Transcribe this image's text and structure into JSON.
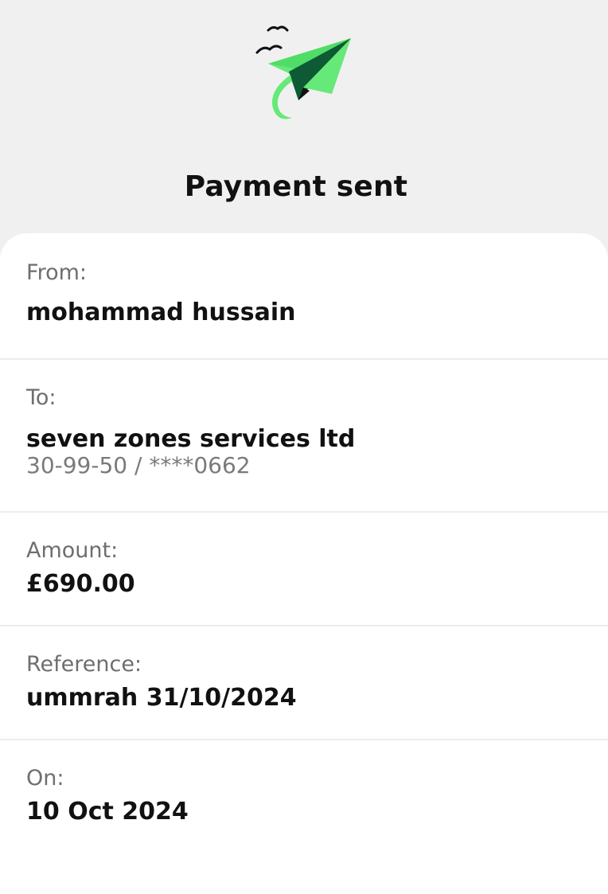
{
  "header": {
    "title": "Payment sent",
    "illustration": "paper-plane-with-birds",
    "accent_color": "#5ee06b",
    "accent_dark": "#0e4d2f"
  },
  "details": {
    "from": {
      "label": "From:",
      "value": "mohammad hussain"
    },
    "to": {
      "label": "To:",
      "value": "seven zones services ltd",
      "account": "30-99-50 / ****0662"
    },
    "amount": {
      "label": "Amount:",
      "value": "£690.00"
    },
    "reference": {
      "label": "Reference:",
      "value": "ummrah 31/10/2024"
    },
    "date": {
      "label": "On:",
      "value": "10 Oct 2024"
    }
  }
}
